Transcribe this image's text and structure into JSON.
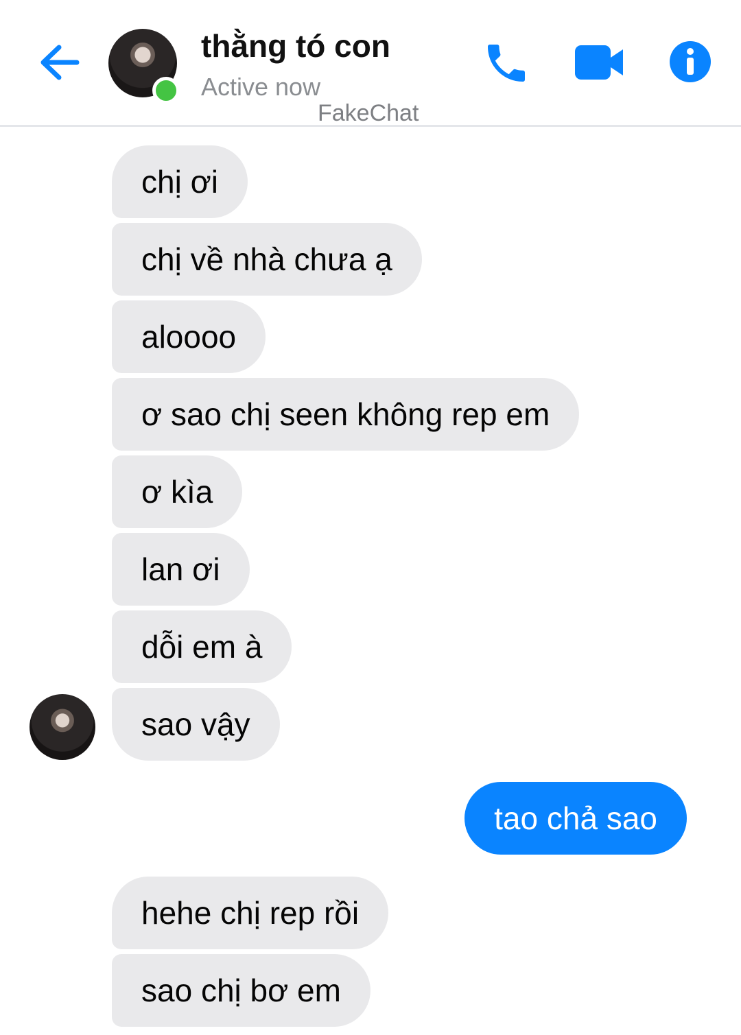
{
  "header": {
    "contact_name": "thằng tó con",
    "status": "Active now",
    "watermark": "FakeChat"
  },
  "icons": {
    "back": "arrow-left-icon",
    "call": "phone-icon",
    "video": "video-camera-icon",
    "info": "info-icon"
  },
  "colors": {
    "accent": "#0a84ff",
    "incoming_bubble": "#e9e9eb",
    "online": "#44c443"
  },
  "messages": [
    {
      "from": "them",
      "text": "chị ơi"
    },
    {
      "from": "them",
      "text": "chị về nhà chưa ạ"
    },
    {
      "from": "them",
      "text": "aloooo"
    },
    {
      "from": "them",
      "text": "ơ sao chị seen không rep em"
    },
    {
      "from": "them",
      "text": "ơ kìa"
    },
    {
      "from": "them",
      "text": "lan ơi"
    },
    {
      "from": "them",
      "text": "dỗi em à"
    },
    {
      "from": "them",
      "text": "sao vậy"
    },
    {
      "from": "me",
      "text": "tao chả sao"
    },
    {
      "from": "them",
      "text": "hehe chị rep rồi"
    },
    {
      "from": "them",
      "text": "sao chị bơ em"
    }
  ]
}
